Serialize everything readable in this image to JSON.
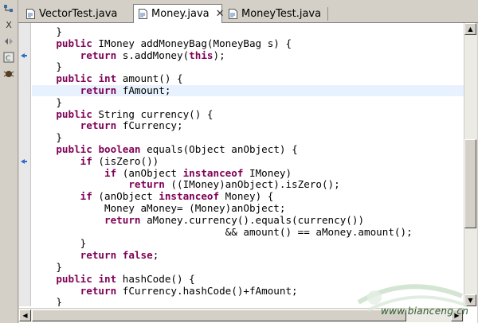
{
  "tabs": [
    {
      "label": "VectorTest.java",
      "active": false
    },
    {
      "label": "Money.java",
      "active": true,
      "close": "✕"
    },
    {
      "label": "MoneyTest.java",
      "active": false
    }
  ],
  "toolbar_icons": [
    "hierarchy-icon",
    "close-x-icon",
    "diff-icon",
    "class-icon",
    "bug-icon"
  ],
  "toolbar_glyphs": {
    "close": "X"
  },
  "code_lines": [
    {
      "parts": [
        {
          "t": "    }"
        }
      ]
    },
    {
      "parts": [
        {
          "t": "    "
        },
        {
          "t": "public",
          "k": 1
        },
        {
          "t": " IMoney addMoneyBag(MoneyBag s) {"
        }
      ]
    },
    {
      "parts": [
        {
          "t": "        "
        },
        {
          "t": "return",
          "k": 1
        },
        {
          "t": " s.addMoney("
        },
        {
          "t": "this",
          "k": 1
        },
        {
          "t": ");"
        }
      ]
    },
    {
      "parts": [
        {
          "t": "    }"
        }
      ]
    },
    {
      "parts": [
        {
          "t": "    "
        },
        {
          "t": "public",
          "k": 1
        },
        {
          "t": " "
        },
        {
          "t": "int",
          "k": 1
        },
        {
          "t": " amount() {"
        }
      ]
    },
    {
      "parts": [
        {
          "t": "        "
        },
        {
          "t": "return",
          "k": 1
        },
        {
          "t": " fAmount;"
        }
      ],
      "current": true
    },
    {
      "parts": [
        {
          "t": "    }"
        }
      ]
    },
    {
      "parts": [
        {
          "t": "    "
        },
        {
          "t": "public",
          "k": 1
        },
        {
          "t": " String currency() {"
        }
      ]
    },
    {
      "parts": [
        {
          "t": "        "
        },
        {
          "t": "return",
          "k": 1
        },
        {
          "t": " fCurrency;"
        }
      ]
    },
    {
      "parts": [
        {
          "t": "    }"
        }
      ]
    },
    {
      "parts": [
        {
          "t": "    "
        },
        {
          "t": "public",
          "k": 1
        },
        {
          "t": " "
        },
        {
          "t": "boolean",
          "k": 1
        },
        {
          "t": " equals(Object anObject) {"
        }
      ]
    },
    {
      "parts": [
        {
          "t": "        "
        },
        {
          "t": "if",
          "k": 1
        },
        {
          "t": " (isZero())"
        }
      ]
    },
    {
      "parts": [
        {
          "t": "            "
        },
        {
          "t": "if",
          "k": 1
        },
        {
          "t": " (anObject "
        },
        {
          "t": "instanceof",
          "k": 1
        },
        {
          "t": " IMoney)"
        }
      ]
    },
    {
      "parts": [
        {
          "t": "                "
        },
        {
          "t": "return",
          "k": 1
        },
        {
          "t": " ((IMoney)anObject).isZero();"
        }
      ]
    },
    {
      "parts": [
        {
          "t": "        "
        },
        {
          "t": "if",
          "k": 1
        },
        {
          "t": " (anObject "
        },
        {
          "t": "instanceof",
          "k": 1
        },
        {
          "t": " Money) {"
        }
      ]
    },
    {
      "parts": [
        {
          "t": "            Money aMoney= (Money)anObject;"
        }
      ]
    },
    {
      "parts": [
        {
          "t": "            "
        },
        {
          "t": "return",
          "k": 1
        },
        {
          "t": " aMoney.currency().equals(currency())"
        }
      ]
    },
    {
      "parts": [
        {
          "t": "                                && amount() == aMoney.amount();"
        }
      ]
    },
    {
      "parts": [
        {
          "t": "        }"
        }
      ]
    },
    {
      "parts": [
        {
          "t": "        "
        },
        {
          "t": "return",
          "k": 1
        },
        {
          "t": " "
        },
        {
          "t": "false",
          "k": 1
        },
        {
          "t": ";"
        }
      ]
    },
    {
      "parts": [
        {
          "t": "    }"
        }
      ]
    },
    {
      "parts": [
        {
          "t": "    "
        },
        {
          "t": "public",
          "k": 1
        },
        {
          "t": " "
        },
        {
          "t": "int",
          "k": 1
        },
        {
          "t": " hashCode() {"
        }
      ]
    },
    {
      "parts": [
        {
          "t": "        "
        },
        {
          "t": "return",
          "k": 1
        },
        {
          "t": " fCurrency.hashCode()+fAmount;"
        }
      ]
    },
    {
      "parts": [
        {
          "t": "    }"
        }
      ]
    }
  ],
  "ruler_markers": [
    {
      "line_index": 2,
      "type": "override-indicator-icon"
    },
    {
      "line_index": 11,
      "type": "override-indicator-icon"
    }
  ],
  "scrollbar": {
    "up": "▲",
    "down": "▼",
    "left": "◀",
    "right": "▶"
  },
  "watermark": {
    "text": "www.bianceng.cn"
  },
  "colors": {
    "keyword": "#7f0055",
    "current_line": "#e8f2fe",
    "marker": "#2a6fc9"
  }
}
